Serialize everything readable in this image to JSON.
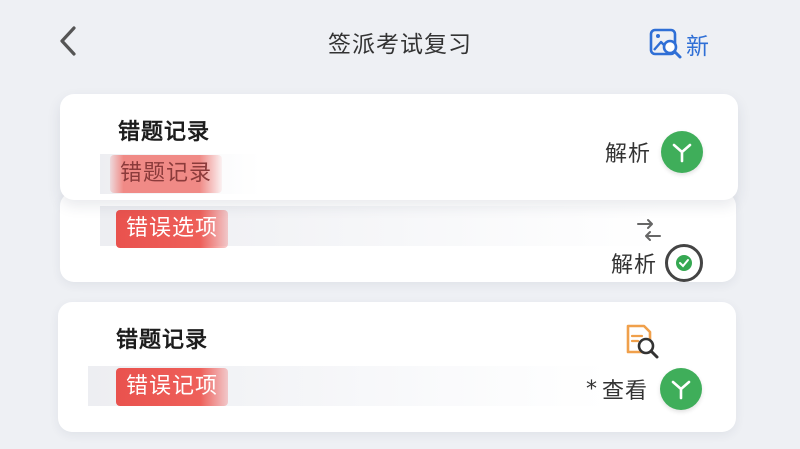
{
  "header": {
    "title": "签派考试复习",
    "new_label": "新"
  },
  "cards": [
    {
      "title": "错题记录",
      "tag": "错题记录",
      "action_label": "解析"
    },
    {
      "tag": "错误选项",
      "action_label": "解析"
    },
    {
      "title": "错题记录",
      "tag": "错误记项",
      "action_prefix": "*",
      "action_label": "查看"
    }
  ],
  "colors": {
    "accent_blue": "#2f6fd6",
    "tag_red": "#e9524e",
    "success_green": "#3fae5a",
    "doc_orange": "#f0a04b"
  },
  "icons": {
    "back": "chevron-left-icon",
    "new": "image-search-icon",
    "analysis": "y-branch-icon",
    "swap": "swap-arrows-icon",
    "refresh": "refresh-circle-icon",
    "doc_search": "document-search-icon"
  }
}
